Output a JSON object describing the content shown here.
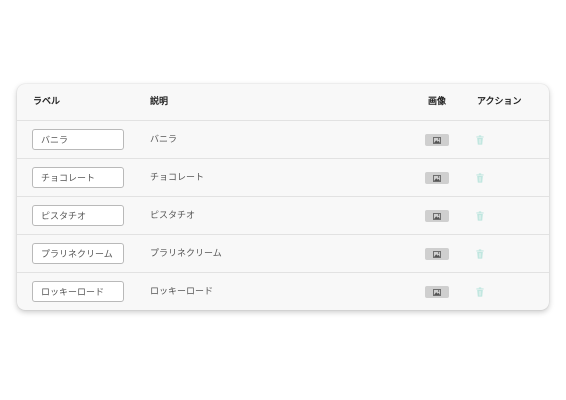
{
  "table": {
    "headers": {
      "label": "ラベル",
      "description": "説明",
      "image": "画像",
      "action": "アクション"
    },
    "rows": [
      {
        "label": "バニラ",
        "description": "バニラ"
      },
      {
        "label": "チョコレート",
        "description": "チョコレート"
      },
      {
        "label": "ピスタチオ",
        "description": "ピスタチオ"
      },
      {
        "label": "プラリネクリーム",
        "description": "プラリネクリーム"
      },
      {
        "label": "ロッキーロード",
        "description": "ロッキーロード"
      }
    ],
    "icons": {
      "image": "image-icon",
      "delete": "trash-icon"
    },
    "colors": {
      "card_background": "#f8f8f8",
      "image_button": "#cfcfcf",
      "delete_icon": "#bfe6df"
    }
  }
}
